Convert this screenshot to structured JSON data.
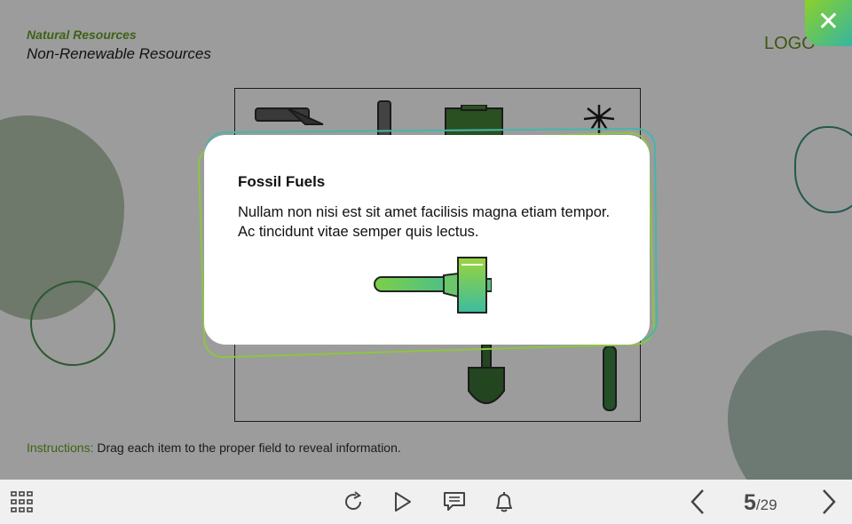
{
  "course": {
    "title": "Natural Resources",
    "lesson": "Non-Renewable Resources"
  },
  "logo": "LOGO",
  "instructions": {
    "label": "Instructions:",
    "text": " Drag each item to the proper field to reveal information."
  },
  "popup": {
    "title": "Fossil Fuels",
    "body": "Nullam non nisi est sit amet facilisis magna etiam tempor. Ac tincidunt vitae semper quis lectus."
  },
  "navigation": {
    "current_page": "5",
    "total_pages": "/29"
  },
  "icons": {
    "close": "close-icon",
    "menu": "grid-menu-icon",
    "replay": "replay-icon",
    "play": "play-icon",
    "transcript": "transcript-icon",
    "notifications": "bell-icon",
    "prev": "chevron-left-icon",
    "next": "chevron-right-icon",
    "popup_item": "fuel-pump-icon"
  },
  "colors": {
    "accent_green": "#8cc63f",
    "accent_teal": "#46b6a8",
    "label_green": "#5d9c1a"
  }
}
